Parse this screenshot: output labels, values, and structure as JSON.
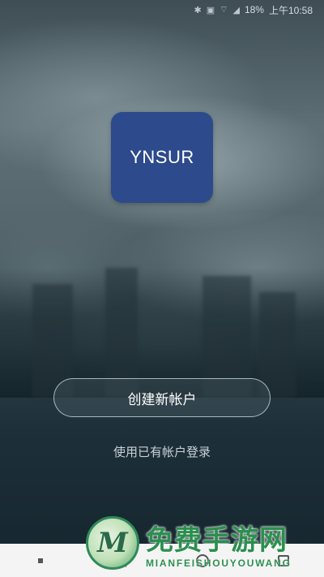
{
  "status_bar": {
    "battery": "18%",
    "time": "上午10:58",
    "icons": [
      "bluetooth-icon",
      "nfc-icon",
      "wifi-off-icon",
      "signal-icon",
      "battery-icon"
    ]
  },
  "logo": {
    "text": "YNSUR"
  },
  "actions": {
    "create_account": "创建新帐户",
    "login_existing": "使用已有帐户登录"
  },
  "nav": {
    "items": [
      "recent-apps",
      "back",
      "home",
      "overview"
    ]
  },
  "watermark": {
    "badge_letter": "M",
    "title": "免费手游网",
    "subtitle": "MIANFEISHOUYOUWANG"
  },
  "colors": {
    "logo_bg": "#2c4a8c",
    "watermark_green": "#2b8f4e"
  }
}
